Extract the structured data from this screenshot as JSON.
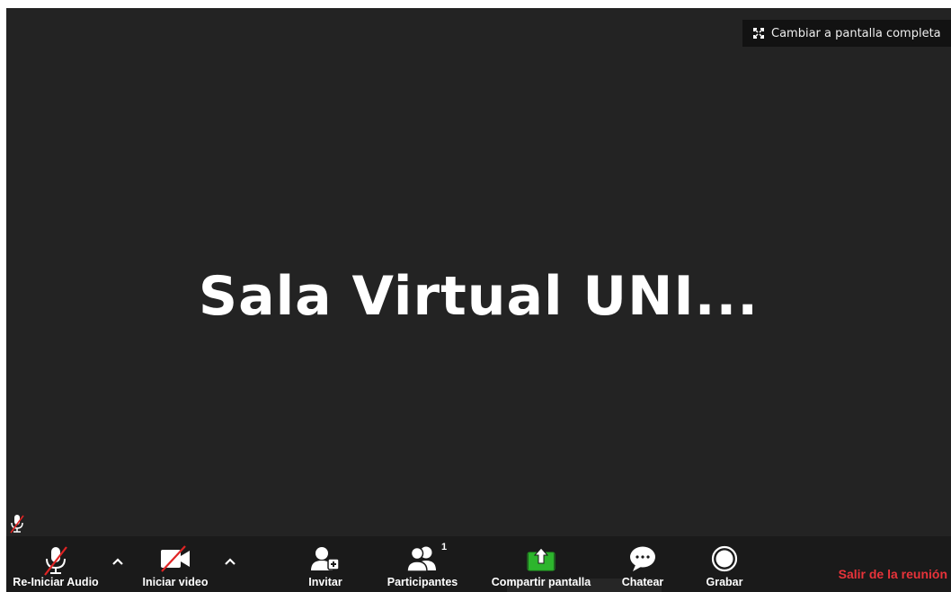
{
  "fullscreen": {
    "label": "Cambiar a pantalla completa"
  },
  "meeting": {
    "title": "Sala Virtual UNI..."
  },
  "toolbar": {
    "audio_label": "Re-Iniciar Audio",
    "video_label": "Iniciar video",
    "invite_label": "Invitar",
    "participants_label": "Participantes",
    "participants_count": "1",
    "share_label": "Compartir pantalla",
    "chat_label": "Chatear",
    "record_label": "Grabar",
    "leave_label": "Salir de la reunión"
  },
  "colors": {
    "background": "#232323",
    "toolbar": "#1a1a1a",
    "share_green": "#2db52d",
    "leave_red": "#e8333a",
    "muted_red": "#e02424"
  },
  "icons": {
    "fullscreen": "expand-icon",
    "audio": "microphone-muted-icon",
    "video": "video-camera-off-icon",
    "invite": "add-user-icon",
    "participants": "participants-icon",
    "share": "share-screen-icon",
    "chat": "chat-bubble-icon",
    "record": "record-icon"
  }
}
